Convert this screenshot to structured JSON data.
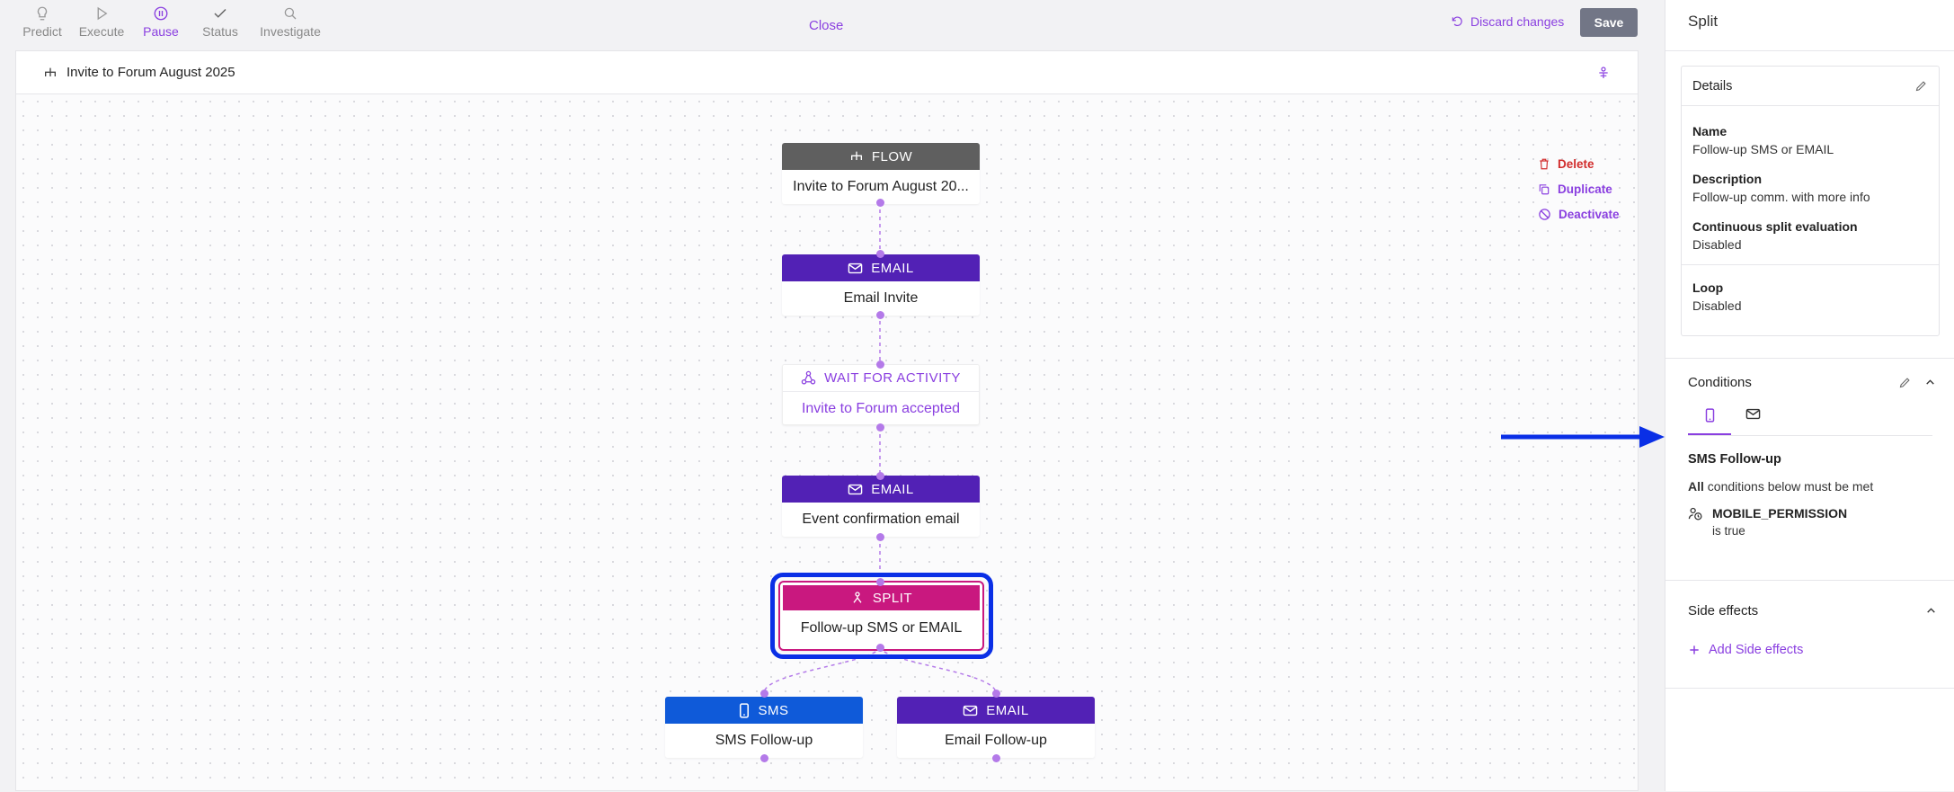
{
  "toolbar": {
    "modes": [
      {
        "label": "Predict",
        "icon": "bulb-icon"
      },
      {
        "label": "Execute",
        "icon": "play-icon"
      },
      {
        "label": "Pause",
        "icon": "pause-icon",
        "active": true
      },
      {
        "label": "Status",
        "icon": "check-icon"
      },
      {
        "label": "Investigate",
        "icon": "search-icon"
      }
    ],
    "close_label": "Close",
    "discard_label": "Discard changes",
    "save_label": "Save"
  },
  "canvas": {
    "flow_title": "Invite to Forum August 2025",
    "actions": {
      "delete": "Delete",
      "duplicate": "Duplicate",
      "deactivate": "Deactivate"
    },
    "nodes": {
      "flow": {
        "type": "FLOW",
        "name": "Invite to Forum August 20..."
      },
      "email1": {
        "type": "EMAIL",
        "name": "Email Invite"
      },
      "wait": {
        "type": "WAIT FOR ACTIVITY",
        "name": "Invite to Forum accepted"
      },
      "email2": {
        "type": "EMAIL",
        "name": "Event confirmation email"
      },
      "split": {
        "type": "SPLIT",
        "name": "Follow-up SMS or EMAIL"
      },
      "sms": {
        "type": "SMS",
        "name": "SMS Follow-up"
      },
      "email3": {
        "type": "EMAIL",
        "name": "Email Follow-up"
      }
    }
  },
  "panel": {
    "title": "Split",
    "details": {
      "heading": "Details",
      "name_label": "Name",
      "name_value": "Follow-up SMS or EMAIL",
      "desc_label": "Description",
      "desc_value": "Follow-up comm. with more info",
      "cont_label": "Continuous split evaluation",
      "cont_value": "Disabled",
      "loop_label": "Loop",
      "loop_value": "Disabled"
    },
    "conditions": {
      "heading": "Conditions",
      "branch_title": "SMS Follow-up",
      "rule_prefix": "All",
      "rule_suffix": " conditions below must be met",
      "condition_name": "MOBILE_PERMISSION",
      "condition_value": "is true"
    },
    "side_effects": {
      "heading": "Side effects",
      "add_label": "Add Side effects"
    }
  },
  "colors": {
    "accent": "#8a3fe0",
    "email": "#5221b5",
    "split": "#c9187f",
    "sms": "#0f5ad9",
    "flow": "#5f5f5f",
    "highlight": "#0a2fe6",
    "delete": "#d12c2c"
  }
}
